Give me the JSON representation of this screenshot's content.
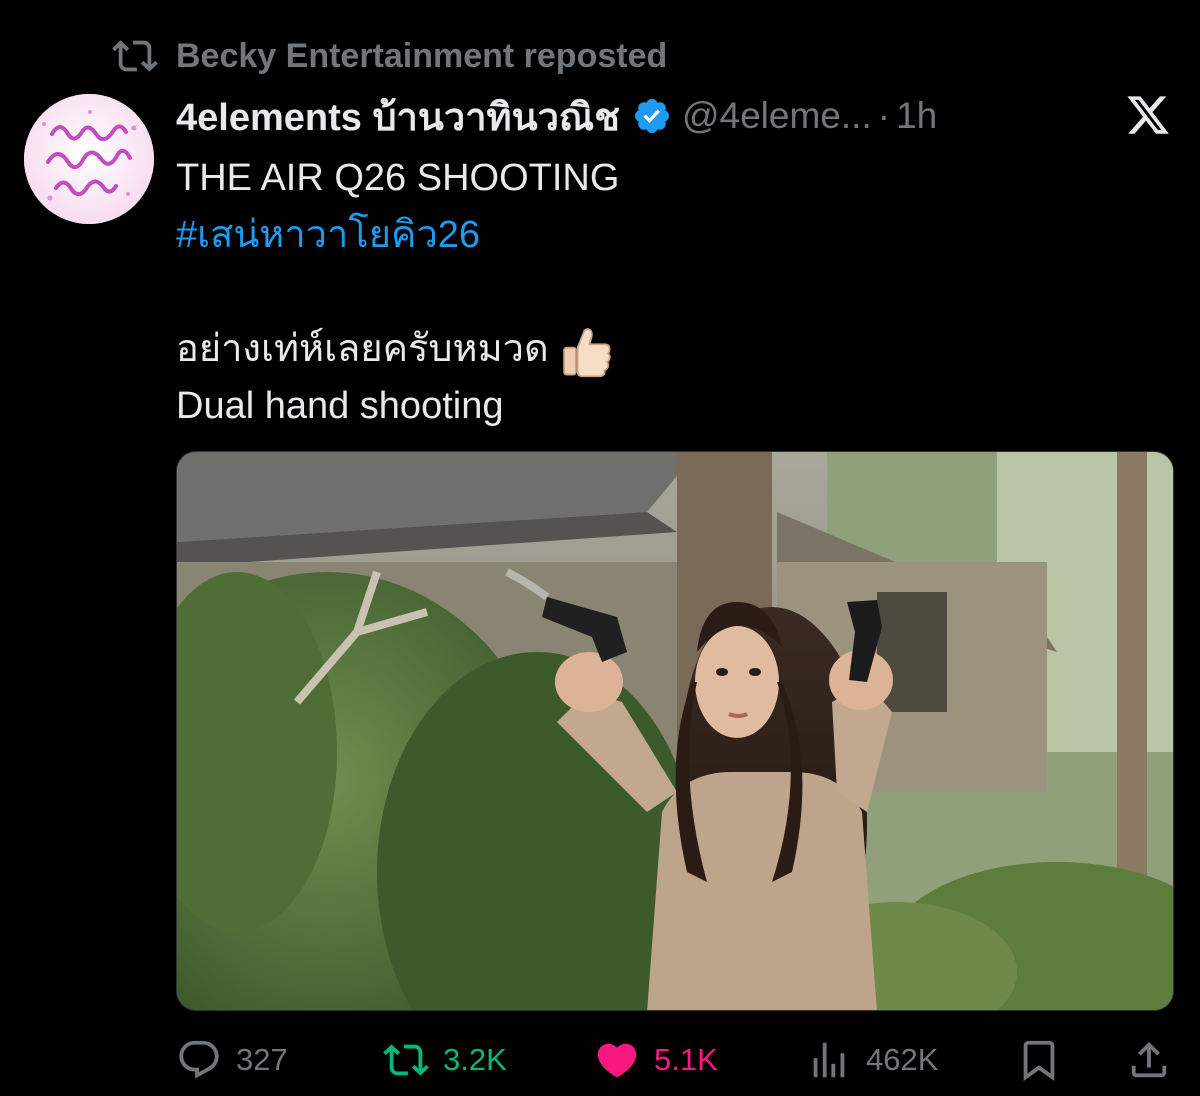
{
  "repost_banner": {
    "text": "Becky Entertainment reposted",
    "icon": "repost-icon"
  },
  "author": {
    "display_name": "4elements บ้านวาทินวณิช",
    "handle": "@4eleme...",
    "separator": "·",
    "time": "1h",
    "verified": true,
    "avatar_icon": "avatar-logo",
    "avatar_text": "บ้านวาทินวณิช"
  },
  "platform_logo": "x-logo-icon",
  "tweet": {
    "line1": "THE AIR Q26 SHOOTING",
    "hashtag": "#เสน่หาวาโยคิว26",
    "line3": "อย่างเท่ห์เลยครับหมวด",
    "emoji": "thumbs-up-icon",
    "line4": "Dual hand shooting"
  },
  "media": {
    "icon": "photo-woman-dual-pistols"
  },
  "actions": {
    "replies": "327",
    "reposts": "3.2K",
    "likes": "5.1K",
    "views": "462K"
  },
  "colors": {
    "background": "#000000",
    "text": "#e7e9ea",
    "muted": "#71767b",
    "link": "#1d9bf0",
    "repost_green": "#00ba7c",
    "like_pink": "#f91880",
    "verified_blue": "#1d9bf0"
  }
}
